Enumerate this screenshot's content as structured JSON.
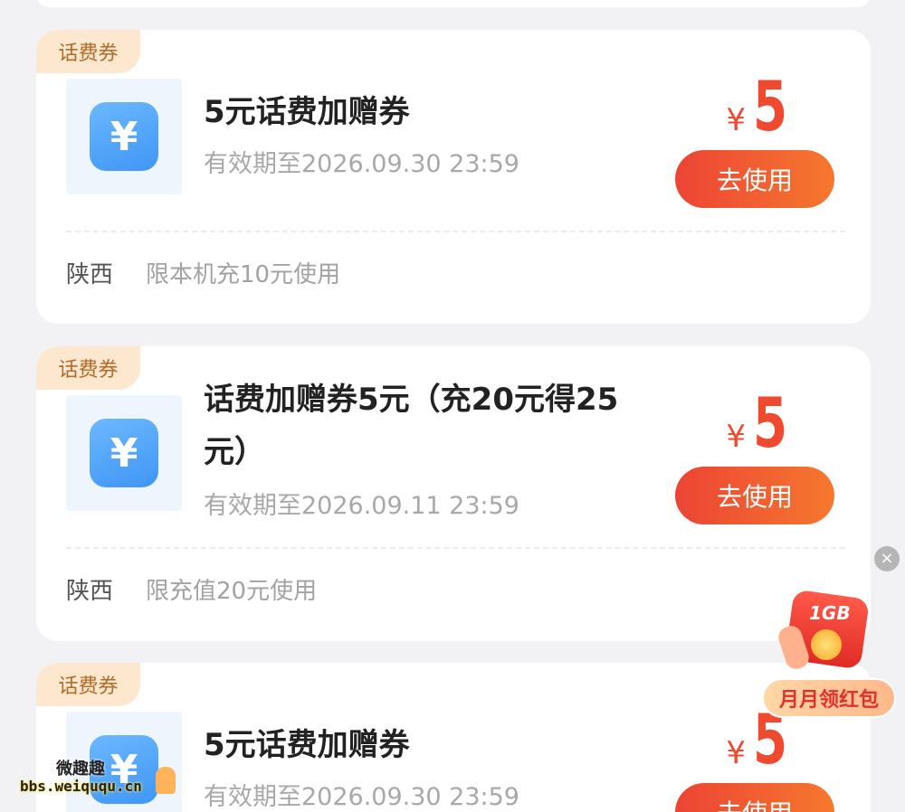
{
  "coupons": [
    {
      "tag": "话费券",
      "title": "5元话费加赠券",
      "validity": "有效期至2026.09.30 23:59",
      "currency": "¥",
      "amount": "5",
      "button": "去使用",
      "region": "陕西",
      "condition": "限本机充10元使用"
    },
    {
      "tag": "话费券",
      "title": "话费加赠券5元（充20元得25元）",
      "validity": "有效期至2026.09.11 23:59",
      "currency": "¥",
      "amount": "5",
      "button": "去使用",
      "region": "陕西",
      "condition": "限充值20元使用"
    },
    {
      "tag": "话费券",
      "title": "5元话费加赠券",
      "validity": "有效期至2026.09.30 23:59",
      "currency": "¥",
      "amount": "5",
      "button": "去使用"
    }
  ],
  "icon_glyph": "¥",
  "float_widget": {
    "close": "×",
    "badge": "1GB",
    "label": "月月领红包"
  },
  "watermark": {
    "name": "微趣趣",
    "url": "bbs.weiququ.cn"
  },
  "colors": {
    "accent": "#ef4a2f",
    "tag_bg": "#fde8cf",
    "icon_blue": "#3f96f5"
  }
}
